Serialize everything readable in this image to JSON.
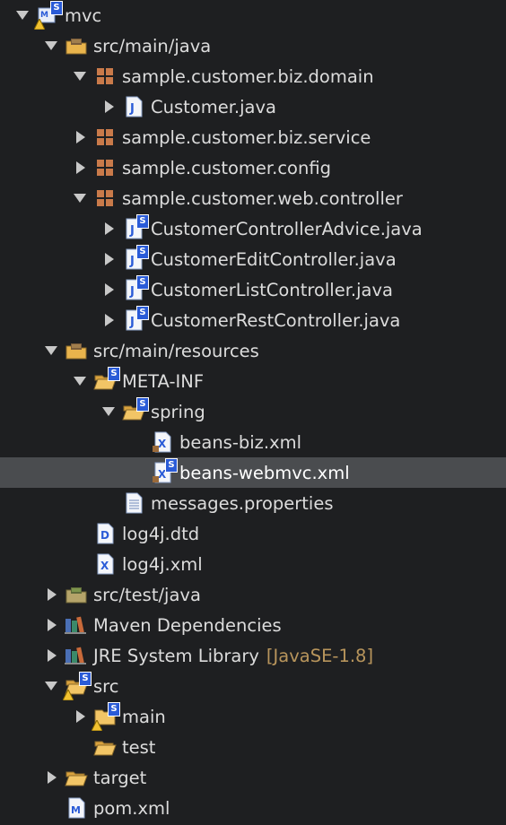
{
  "tree": {
    "root": {
      "label": "mvc"
    },
    "src_main_java": {
      "label": "src/main/java"
    },
    "pkg_domain": {
      "label": "sample.customer.biz.domain"
    },
    "customer_java": {
      "label": "Customer.java"
    },
    "pkg_service": {
      "label": "sample.customer.biz.service"
    },
    "pkg_config": {
      "label": "sample.customer.config"
    },
    "pkg_controller": {
      "label": "sample.customer.web.controller"
    },
    "ctrl_advice": {
      "label": "CustomerControllerAdvice.java"
    },
    "ctrl_edit": {
      "label": "CustomerEditController.java"
    },
    "ctrl_list": {
      "label": "CustomerListController.java"
    },
    "ctrl_rest": {
      "label": "CustomerRestController.java"
    },
    "src_main_resources": {
      "label": "src/main/resources"
    },
    "meta_inf": {
      "label": "META-INF"
    },
    "spring": {
      "label": "spring"
    },
    "beans_biz": {
      "label": "beans-biz.xml"
    },
    "beans_webmvc": {
      "label": "beans-webmvc.xml"
    },
    "messages": {
      "label": "messages.properties"
    },
    "log4j_dtd": {
      "label": "log4j.dtd"
    },
    "log4j_xml": {
      "label": "log4j.xml"
    },
    "src_test_java": {
      "label": "src/test/java"
    },
    "maven_deps": {
      "label": "Maven Dependencies"
    },
    "jre": {
      "label": "JRE System Library",
      "decoration": "[JavaSE-1.8]"
    },
    "src": {
      "label": "src"
    },
    "main": {
      "label": "main"
    },
    "test": {
      "label": "test"
    },
    "target": {
      "label": "target"
    },
    "pom": {
      "label": "pom.xml"
    }
  },
  "colors": {
    "background": "#1e1f21",
    "selection": "#4a4c4f",
    "text": "#dcdcdc",
    "decoration": "#b8955c",
    "spring_badge": "#2a5bd7"
  }
}
